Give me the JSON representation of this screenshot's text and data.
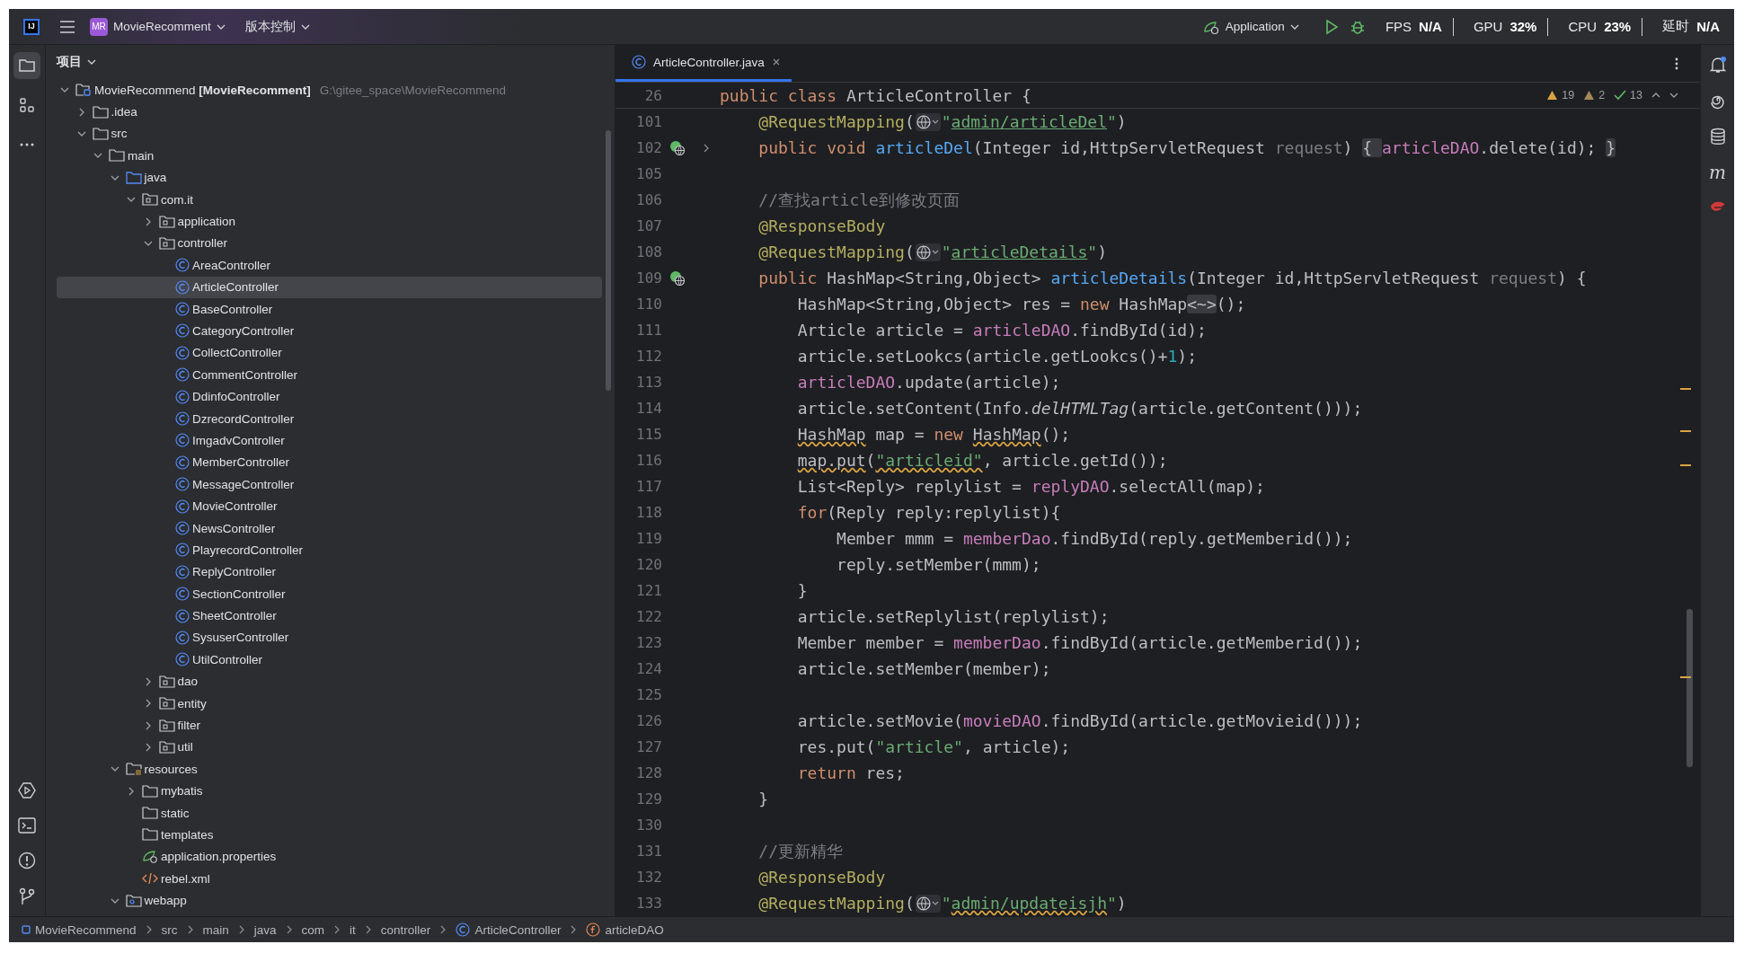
{
  "title_bar": {
    "logo": "IJ",
    "project": {
      "badge": "MR",
      "name": "MovieRecomment"
    },
    "vcs": "版本控制",
    "run_config": "Application",
    "stats": [
      {
        "label": "FPS",
        "value": "N/A"
      },
      {
        "label": "GPU",
        "value": "32%"
      },
      {
        "label": "CPU",
        "value": "23%"
      },
      {
        "label": "延时",
        "value": "N/A"
      }
    ]
  },
  "left_toolbar": {
    "top": [
      {
        "kind": "project",
        "selected": true
      },
      {
        "kind": "structure",
        "selected": false
      },
      {
        "kind": "more",
        "selected": false
      }
    ],
    "bottom": [
      {
        "kind": "run"
      },
      {
        "kind": "terminal"
      },
      {
        "kind": "problems"
      },
      {
        "kind": "git"
      }
    ]
  },
  "project": {
    "title": "项目",
    "tree": [
      {
        "label": "MovieRecommend **[MovieRecomment]**",
        "path": "G:\\gitee_space\\MovieRecommend",
        "kind": "module",
        "expanded": true,
        "selected": false,
        "children": [
          {
            "label": ".idea",
            "kind": "folder",
            "expanded": false,
            "selected": false
          },
          {
            "label": "src",
            "kind": "folder",
            "expanded": true,
            "selected": false,
            "children": [
              {
                "label": "main",
                "kind": "folder",
                "expanded": true,
                "selected": false,
                "children": [
                  {
                    "label": "java",
                    "kind": "source",
                    "expanded": true,
                    "selected": false,
                    "children": [
                      {
                        "label": "com.it",
                        "kind": "package",
                        "expanded": true,
                        "selected": false,
                        "children": [
                          {
                            "label": "application",
                            "kind": "package",
                            "expanded": false,
                            "selected": false
                          },
                          {
                            "label": "controller",
                            "kind": "package",
                            "expanded": true,
                            "selected": false,
                            "children": [
                              {
                                "label": "AreaController",
                                "kind": "class",
                                "selected": false
                              },
                              {
                                "label": "ArticleController",
                                "kind": "class",
                                "selected": true
                              },
                              {
                                "label": "BaseController",
                                "kind": "class",
                                "selected": false
                              },
                              {
                                "label": "CategoryController",
                                "kind": "class",
                                "selected": false
                              },
                              {
                                "label": "CollectController",
                                "kind": "class",
                                "selected": false
                              },
                              {
                                "label": "CommentController",
                                "kind": "class",
                                "selected": false
                              },
                              {
                                "label": "DdinfoController",
                                "kind": "class",
                                "selected": false
                              },
                              {
                                "label": "DzrecordController",
                                "kind": "class",
                                "selected": false
                              },
                              {
                                "label": "ImgadvController",
                                "kind": "class",
                                "selected": false
                              },
                              {
                                "label": "MemberController",
                                "kind": "class",
                                "selected": false
                              },
                              {
                                "label": "MessageController",
                                "kind": "class",
                                "selected": false
                              },
                              {
                                "label": "MovieController",
                                "kind": "class",
                                "selected": false
                              },
                              {
                                "label": "NewsController",
                                "kind": "class",
                                "selected": false
                              },
                              {
                                "label": "PlayrecordController",
                                "kind": "class",
                                "selected": false
                              },
                              {
                                "label": "ReplyController",
                                "kind": "class",
                                "selected": false
                              },
                              {
                                "label": "SectionController",
                                "kind": "class",
                                "selected": false
                              },
                              {
                                "label": "SheetController",
                                "kind": "class",
                                "selected": false
                              },
                              {
                                "label": "SysuserController",
                                "kind": "class",
                                "selected": false
                              },
                              {
                                "label": "UtilController",
                                "kind": "class",
                                "selected": false
                              }
                            ]
                          },
                          {
                            "label": "dao",
                            "kind": "package",
                            "expanded": false,
                            "selected": false
                          },
                          {
                            "label": "entity",
                            "kind": "package",
                            "expanded": false,
                            "selected": false
                          },
                          {
                            "label": "filter",
                            "kind": "package",
                            "expanded": false,
                            "selected": false
                          },
                          {
                            "label": "util",
                            "kind": "package",
                            "expanded": false,
                            "selected": false
                          }
                        ]
                      }
                    ]
                  },
                  {
                    "label": "resources",
                    "kind": "resources",
                    "expanded": true,
                    "selected": false,
                    "children": [
                      {
                        "label": "mybatis",
                        "kind": "folder",
                        "expanded": false,
                        "selected": false
                      },
                      {
                        "label": "static",
                        "kind": "folder",
                        "selected": false
                      },
                      {
                        "label": "templates",
                        "kind": "folder",
                        "selected": false
                      },
                      {
                        "label": "application.properties",
                        "kind": "properties",
                        "selected": false
                      },
                      {
                        "label": "rebel.xml",
                        "kind": "xml",
                        "selected": false
                      }
                    ]
                  },
                  {
                    "label": "webapp",
                    "kind": "webapp",
                    "expanded": true,
                    "selected": false
                  }
                ]
              }
            ]
          }
        ]
      }
    ]
  },
  "editor": {
    "tabs": [
      {
        "label": "ArticleController.java",
        "selected": true
      }
    ],
    "inspections": {
      "warnings": "19",
      "weak_warnings": "2",
      "passed": "13"
    },
    "sticky": {
      "number": "26",
      "tokens": [
        {
          "text": "public class ",
          "kind": "keyword"
        },
        {
          "text": "ArticleController {",
          "kind": "plain"
        }
      ]
    },
    "lines": [
      {
        "number": "101",
        "tokens": [
          {
            "text": "    @RequestMapping",
            "kind": "annotation"
          },
          {
            "text": "(",
            "kind": "plain"
          },
          {
            "kind": "globe"
          },
          {
            "text": "\"",
            "kind": "string"
          },
          {
            "text": "admin/articleDel",
            "kind": "url"
          },
          {
            "text": "\"",
            "kind": "string"
          },
          {
            "text": ")",
            "kind": "plain"
          }
        ]
      },
      {
        "number": "102",
        "endpoint": true,
        "folded": true,
        "tokens": [
          {
            "text": "    public void ",
            "kind": "keyword"
          },
          {
            "text": "articleDel",
            "kind": "declaration"
          },
          {
            "text": "(Integer id,HttpServletRequest ",
            "kind": "plain"
          },
          {
            "text": "request",
            "kind": "unused"
          },
          {
            "text": ")",
            "kind": "plain"
          },
          {
            "text": " { ",
            "kind": "fold"
          },
          {
            "text": "articleDAO",
            "kind": "field"
          },
          {
            "text": ".delete(id);",
            "kind": "plain"
          },
          {
            "text": " }",
            "kind": "fold"
          }
        ]
      },
      {
        "number": "105"
      },
      {
        "number": "106",
        "tokens": [
          {
            "text": "    //查找article到修改页面",
            "kind": "comment"
          }
        ]
      },
      {
        "number": "107",
        "tokens": [
          {
            "text": "    @ResponseBody",
            "kind": "annotation"
          }
        ]
      },
      {
        "number": "108",
        "tokens": [
          {
            "text": "    @RequestMapping",
            "kind": "annotation"
          },
          {
            "text": "(",
            "kind": "plain"
          },
          {
            "kind": "globe"
          },
          {
            "text": "\"",
            "kind": "string"
          },
          {
            "text": "articleDetails",
            "kind": "url"
          },
          {
            "text": "\"",
            "kind": "string"
          },
          {
            "text": ")",
            "kind": "plain"
          }
        ]
      },
      {
        "number": "109",
        "endpoint": true,
        "tokens": [
          {
            "text": "    public ",
            "kind": "keyword"
          },
          {
            "text": "HashMap<String,Object> ",
            "kind": "plain"
          },
          {
            "text": "articleDetails",
            "kind": "declaration"
          },
          {
            "text": "(Integer id,HttpServletRequest ",
            "kind": "plain"
          },
          {
            "text": "request",
            "kind": "unused"
          },
          {
            "text": ") {",
            "kind": "plain"
          }
        ]
      },
      {
        "number": "110",
        "tokens": [
          {
            "text": "        HashMap<String,Object> res = ",
            "kind": "plain"
          },
          {
            "text": "new ",
            "kind": "keyword"
          },
          {
            "text": "HashMap",
            "kind": "plain"
          },
          {
            "text": "<~>",
            "kind": "fold"
          },
          {
            "text": "();",
            "kind": "plain"
          }
        ]
      },
      {
        "number": "111",
        "tokens": [
          {
            "text": "        Article article = ",
            "kind": "plain"
          },
          {
            "text": "articleDAO",
            "kind": "field"
          },
          {
            "text": ".findById(id);",
            "kind": "plain"
          }
        ]
      },
      {
        "number": "112",
        "tokens": [
          {
            "text": "        article.setLookcs(article.getLookcs()+",
            "kind": "plain"
          },
          {
            "text": "1",
            "kind": "number"
          },
          {
            "text": ");",
            "kind": "plain"
          }
        ]
      },
      {
        "number": "113",
        "tokens": [
          {
            "text": "        articleDAO",
            "kind": "field"
          },
          {
            "text": ".update(article);",
            "kind": "plain"
          }
        ]
      },
      {
        "number": "114",
        "tokens": [
          {
            "text": "        article.setContent(Info.",
            "kind": "plain"
          },
          {
            "text": "delHTMLTag",
            "kind": "italic"
          },
          {
            "text": "(article.getContent()));",
            "kind": "plain"
          }
        ]
      },
      {
        "number": "115",
        "tokens": [
          {
            "text": "        HashMap",
            "kind": "wavy"
          },
          {
            "text": " map = ",
            "kind": "plain"
          },
          {
            "text": "new ",
            "kind": "keyword"
          },
          {
            "text": "HashMap",
            "kind": "wavy"
          },
          {
            "text": "();",
            "kind": "plain"
          }
        ]
      },
      {
        "number": "116",
        "tokens": [
          {
            "text": "        map.put",
            "kind": "wavy"
          },
          {
            "text": "(",
            "kind": "plain"
          },
          {
            "text": "\"articleid\"",
            "kind": "wavystring"
          },
          {
            "text": ", article.getId());",
            "kind": "plain"
          }
        ]
      },
      {
        "number": "117",
        "tokens": [
          {
            "text": "        List<Reply> replylist = ",
            "kind": "plain"
          },
          {
            "text": "replyDAO",
            "kind": "field"
          },
          {
            "text": ".selectAll(map);",
            "kind": "plain"
          }
        ]
      },
      {
        "number": "118",
        "tokens": [
          {
            "text": "        for",
            "kind": "keyword"
          },
          {
            "text": "(Reply reply:replylist){",
            "kind": "plain"
          }
        ]
      },
      {
        "number": "119",
        "tokens": [
          {
            "text": "            Member mmm = ",
            "kind": "plain"
          },
          {
            "text": "memberDao",
            "kind": "field"
          },
          {
            "text": ".findById(reply.getMemberid());",
            "kind": "plain"
          }
        ]
      },
      {
        "number": "120",
        "tokens": [
          {
            "text": "            reply.setMember(mmm);",
            "kind": "plain"
          }
        ]
      },
      {
        "number": "121",
        "tokens": [
          {
            "text": "        }",
            "kind": "plain"
          }
        ]
      },
      {
        "number": "122",
        "tokens": [
          {
            "text": "        article.setReplylist(replylist);",
            "kind": "plain"
          }
        ]
      },
      {
        "number": "123",
        "tokens": [
          {
            "text": "        Member member = ",
            "kind": "plain"
          },
          {
            "text": "memberDao",
            "kind": "field"
          },
          {
            "text": ".findById(article.getMemberid());",
            "kind": "plain"
          }
        ]
      },
      {
        "number": "124",
        "tokens": [
          {
            "text": "        article.setMember(member);",
            "kind": "plain"
          }
        ]
      },
      {
        "number": "125"
      },
      {
        "number": "126",
        "tokens": [
          {
            "text": "        article.setMovie(",
            "kind": "plain"
          },
          {
            "text": "movieDAO",
            "kind": "field"
          },
          {
            "text": ".findById(article.getMovieid()));",
            "kind": "plain"
          }
        ]
      },
      {
        "number": "127",
        "tokens": [
          {
            "text": "        res.put(",
            "kind": "plain"
          },
          {
            "text": "\"article\"",
            "kind": "string"
          },
          {
            "text": ", article);",
            "kind": "plain"
          }
        ]
      },
      {
        "number": "128",
        "tokens": [
          {
            "text": "        return",
            "kind": "keyword"
          },
          {
            "text": " res;",
            "kind": "plain"
          }
        ]
      },
      {
        "number": "129",
        "tokens": [
          {
            "text": "    }",
            "kind": "plain"
          }
        ]
      },
      {
        "number": "130"
      },
      {
        "number": "131",
        "tokens": [
          {
            "text": "    //更新精华",
            "kind": "comment"
          }
        ]
      },
      {
        "number": "132",
        "tokens": [
          {
            "text": "    @ResponseBody",
            "kind": "annotation"
          }
        ]
      },
      {
        "number": "133",
        "tokens": [
          {
            "text": "    @RequestMapping",
            "kind": "annotation"
          },
          {
            "text": "(",
            "kind": "plain"
          },
          {
            "kind": "globe"
          },
          {
            "text": "\"",
            "kind": "string"
          },
          {
            "text": "admin/updateisjh",
            "kind": "wavyurl"
          },
          {
            "text": "\"",
            "kind": "string"
          },
          {
            "text": ")",
            "kind": "plain"
          }
        ]
      }
    ]
  },
  "right_toolbar": [
    {
      "kind": "notifications",
      "badge": true
    },
    {
      "kind": "ai"
    },
    {
      "kind": "database"
    },
    {
      "kind": "letter",
      "text": "m"
    },
    {
      "kind": "plugin"
    }
  ],
  "breadcrumbs": [
    {
      "label": "MovieRecommend",
      "kind": "module"
    },
    {
      "label": "src",
      "kind": "plain"
    },
    {
      "label": "main",
      "kind": "plain"
    },
    {
      "label": "java",
      "kind": "plain"
    },
    {
      "label": "com",
      "kind": "plain"
    },
    {
      "label": "it",
      "kind": "plain"
    },
    {
      "label": "controller",
      "kind": "plain"
    },
    {
      "label": "ArticleController",
      "kind": "class"
    },
    {
      "label": "articleDAO",
      "kind": "field"
    }
  ]
}
